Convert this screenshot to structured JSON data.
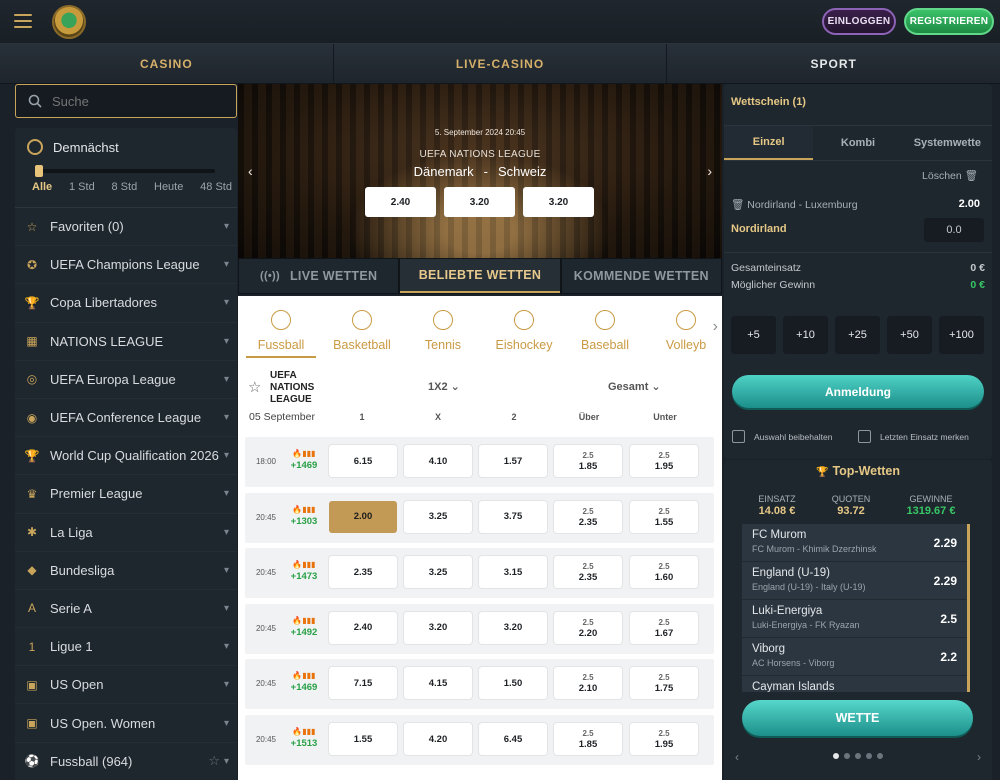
{
  "header": {
    "login_label": "EINLOGGEN",
    "register_label": "REGISTRIEREN"
  },
  "nav": {
    "items": [
      "CASINO",
      "LIVE-CASINO",
      "SPORT"
    ]
  },
  "search": {
    "placeholder": "Suche"
  },
  "sidebar": {
    "soon_title": "Demnächst",
    "slider_labels": [
      "Alle",
      "1 Std",
      "8 Std",
      "Heute",
      "48 Std"
    ],
    "slider_value_fraction": 0.0,
    "leagues": [
      {
        "label": "Favoriten (0)",
        "icon": "star-icon"
      },
      {
        "label": "UEFA Champions League",
        "icon": "champions-league-icon"
      },
      {
        "label": "Copa Libertadores",
        "icon": "trophy-icon"
      },
      {
        "label": "NATIONS LEAGUE",
        "icon": "nations-league-icon"
      },
      {
        "label": "UEFA Europa League",
        "icon": "europa-league-icon"
      },
      {
        "label": "UEFA Conference League",
        "icon": "conference-league-icon"
      },
      {
        "label": "World Cup Qualification 2026",
        "icon": "world-cup-icon"
      },
      {
        "label": "Premier League",
        "icon": "premier-league-icon"
      },
      {
        "label": "La Liga",
        "icon": "la-liga-icon"
      },
      {
        "label": "Bundesliga",
        "icon": "bundesliga-icon"
      },
      {
        "label": "Serie A",
        "icon": "serie-a-icon"
      },
      {
        "label": "Ligue 1",
        "icon": "ligue-1-icon"
      },
      {
        "label": "US Open",
        "icon": "us-open-icon"
      },
      {
        "label": "US Open. Women",
        "icon": "us-open-icon"
      },
      {
        "label": "Fussball (964)",
        "icon": "football-icon"
      }
    ]
  },
  "hero": {
    "date": "5. September 2024 20:45",
    "league": "UEFA NATIONS LEAGUE",
    "home": "Dänemark",
    "separator": "-",
    "away": "Schweiz",
    "odds": [
      "2.40",
      "3.20",
      "3.20"
    ]
  },
  "tabs": [
    "LIVE WETTEN",
    "BELIEBTE WETTEN",
    "KOMMENDE WETTEN"
  ],
  "sports": [
    "Fussball",
    "Basketball",
    "Tennis",
    "Eishockey",
    "Baseball",
    "Volleyb"
  ],
  "table": {
    "league": "UEFA NATIONS LEAGUE",
    "market": "1X2",
    "total": "Gesamt",
    "day": "05 September",
    "columns": [
      "1",
      "X",
      "2",
      "Über",
      "Unter"
    ],
    "rows": [
      {
        "time": "18:00",
        "count": "+1469",
        "o1": "6.15",
        "ox": "4.10",
        "o2": "1.57",
        "line": "2.5",
        "over": "1.85",
        "under": "1.95",
        "selected": false
      },
      {
        "time": "20:45",
        "count": "+1303",
        "o1": "2.00",
        "ox": "3.25",
        "o2": "3.75",
        "line": "2.5",
        "over": "2.35",
        "under": "1.55",
        "selected": true
      },
      {
        "time": "20:45",
        "count": "+1473",
        "o1": "2.35",
        "ox": "3.25",
        "o2": "3.15",
        "line": "2.5",
        "over": "2.35",
        "under": "1.60",
        "selected": false
      },
      {
        "time": "20:45",
        "count": "+1492",
        "o1": "2.40",
        "ox": "3.20",
        "o2": "3.20",
        "line": "2.5",
        "over": "2.20",
        "under": "1.67",
        "selected": false
      },
      {
        "time": "20:45",
        "count": "+1469",
        "o1": "7.15",
        "ox": "4.15",
        "o2": "1.50",
        "line": "2.5",
        "over": "2.10",
        "under": "1.75",
        "selected": false
      },
      {
        "time": "20:45",
        "count": "+1513",
        "o1": "1.55",
        "ox": "4.20",
        "o2": "6.45",
        "line": "2.5",
        "over": "1.85",
        "under": "1.95",
        "selected": false
      }
    ]
  },
  "betslip": {
    "title": "Wettschein (1)",
    "tabs": [
      "Einzel",
      "Kombi",
      "Systemwette"
    ],
    "clear_label": "Löschen",
    "match": "Nordirland - Luxemburg",
    "match_odd": "2.00",
    "pick": "Nordirland",
    "stake": "0.0",
    "total_stake_label": "Gesamteinsatz",
    "total_stake_value": "0 €",
    "potential_win_label": "Möglicher Gewinn",
    "potential_win_value": "0 €",
    "quick_stakes": [
      "+5",
      "+10",
      "+25",
      "+50",
      "+100"
    ],
    "login_button": "Anmeldung",
    "keep_selection": "Auswahl beibehalten",
    "remember_stake": "Letzten Einsatz merken"
  },
  "top_bets": {
    "title": "Top-Wetten",
    "stake_label": "EINSATZ",
    "stake_value": "14.08 €",
    "odds_label": "QUOTEN",
    "odds_value": "93.72",
    "win_label": "GEWINNE",
    "win_value": "1319.67 €",
    "items": [
      {
        "pick": "FC Murom",
        "match": "FC Murom - Khimik Dzerzhinsk",
        "odd": "2.29"
      },
      {
        "pick": "England (U-19)",
        "match": "England (U-19) - Italy (U-19)",
        "odd": "2.29"
      },
      {
        "pick": "Luki-Energiya",
        "match": "Luki-Energiya - FK Ryazan",
        "odd": "2.5"
      },
      {
        "pick": "Viborg",
        "match": "AC Horsens - Viborg",
        "odd": "2.2"
      },
      {
        "pick": "Cayman Islands",
        "match": "",
        "odd": ""
      }
    ],
    "bet_button": "WETTE"
  },
  "colors": {
    "accent_gold": "#c9a55b",
    "teal": "#1c8f8a",
    "green": "#37c765",
    "selected_odd": "#c29a55"
  }
}
